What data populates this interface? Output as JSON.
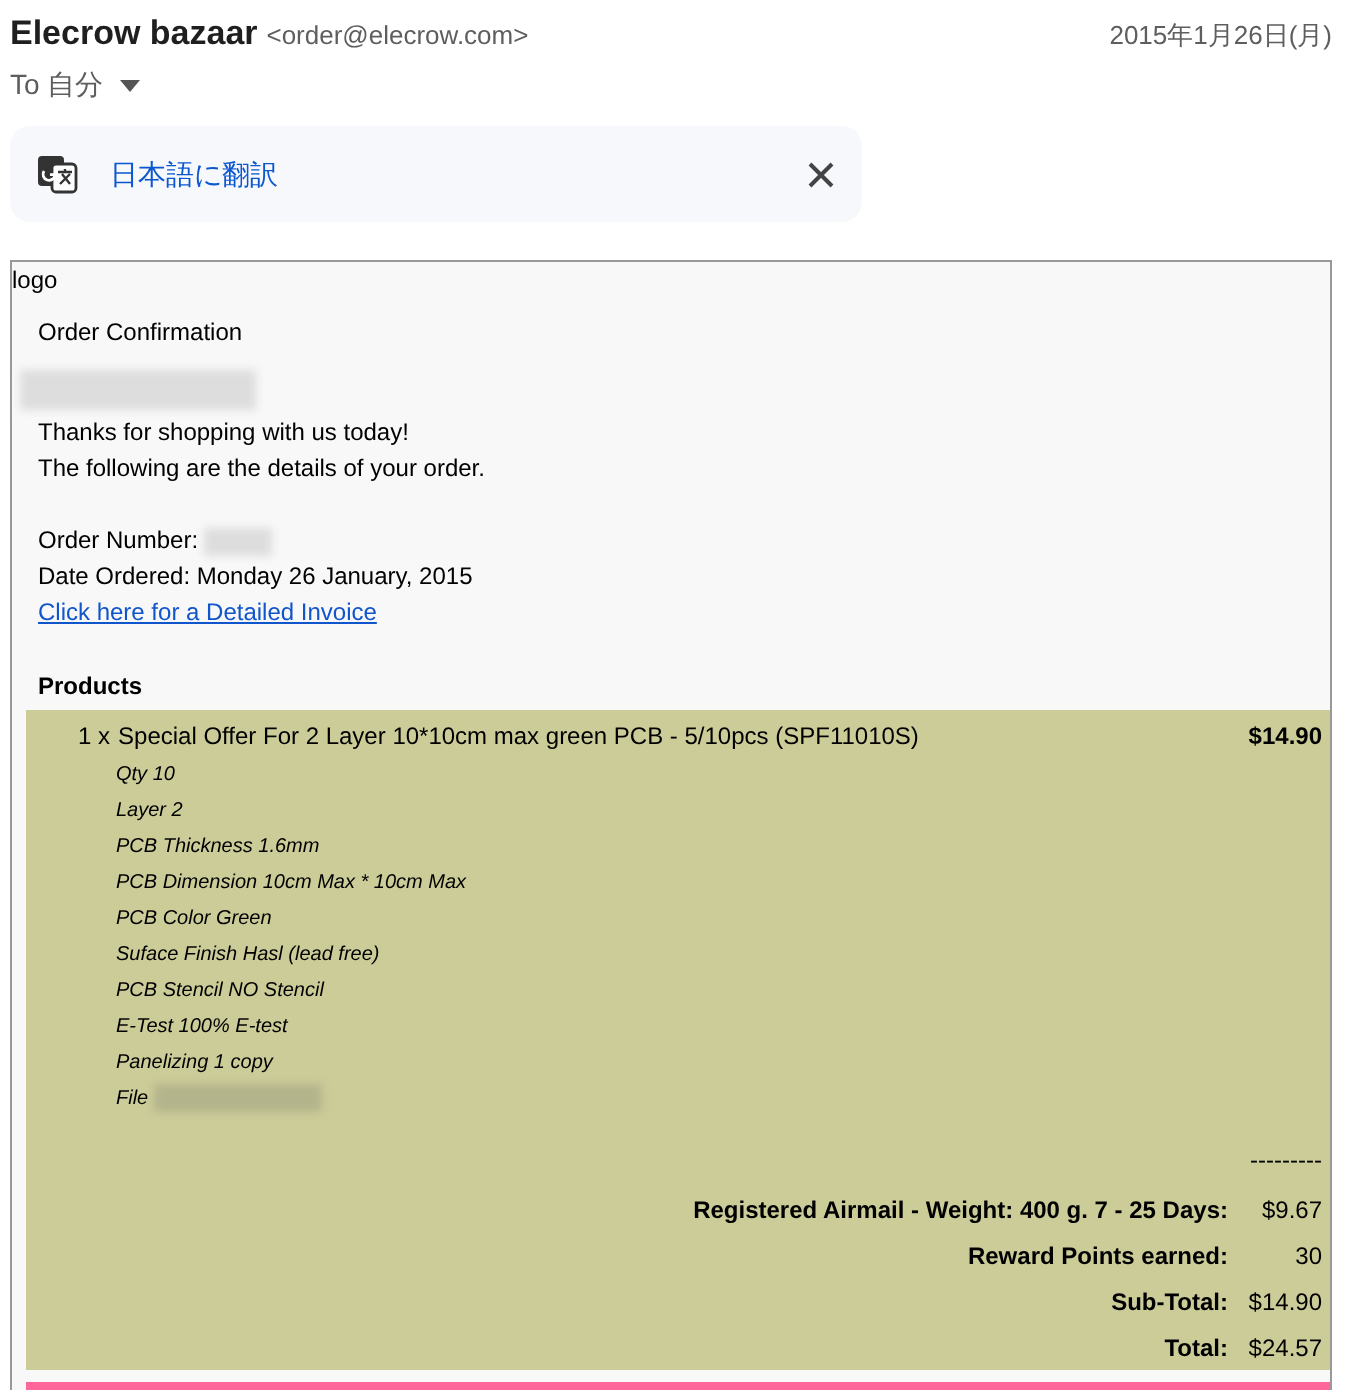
{
  "header": {
    "sender_name": "Elecrow bazaar",
    "sender_email": "<order@elecrow.com>",
    "date": "2015年1月26日(月)",
    "recipient": "To 自分"
  },
  "translate_bar": {
    "label": "日本語に翻訳"
  },
  "email": {
    "logo_alt": "logo",
    "title": "Order Confirmation",
    "lines": [
      {
        "kind": "redacted"
      },
      {
        "kind": "text",
        "text": "Thanks for shopping with us today!"
      },
      {
        "kind": "text",
        "text": "The following are the details of your order."
      },
      {
        "kind": "blank"
      },
      {
        "kind": "field",
        "text": "Order Number:"
      },
      {
        "kind": "text",
        "text": "Date Ordered: Monday 26 January, 2015"
      },
      {
        "kind": "link",
        "text": "Click here for a Detailed Invoice"
      }
    ],
    "products_heading": "Products",
    "product": {
      "quantity": "1 x",
      "name": "Special Offer For 2 Layer 10*10cm max green PCB - 5/10pcs (SPF11010S)",
      "price": "$14.90",
      "options": [
        {
          "text": "Qty 10",
          "redacted": false
        },
        {
          "text": "Layer 2",
          "redacted": false
        },
        {
          "text": "PCB Thickness 1.6mm",
          "redacted": false
        },
        {
          "text": "PCB Dimension 10cm Max * 10cm Max",
          "redacted": false
        },
        {
          "text": "PCB Color Green",
          "redacted": false
        },
        {
          "text": "Suface Finish Hasl (lead free)",
          "redacted": false
        },
        {
          "text": "PCB Stencil NO Stencil",
          "redacted": false
        },
        {
          "text": "E-Test 100% E-test",
          "redacted": false
        },
        {
          "text": "Panelizing 1 copy",
          "redacted": false
        },
        {
          "text": "File",
          "redacted": true
        }
      ]
    },
    "separator": "---------",
    "totals": [
      {
        "label": "Registered Airmail - Weight: 400 g. 7 - 25 Days:",
        "value": "$9.67"
      },
      {
        "label": "Reward Points earned:",
        "value": "30"
      },
      {
        "label": "Sub-Total:",
        "value": "$14.90"
      },
      {
        "label": "Total:",
        "value": "$24.57"
      }
    ]
  }
}
